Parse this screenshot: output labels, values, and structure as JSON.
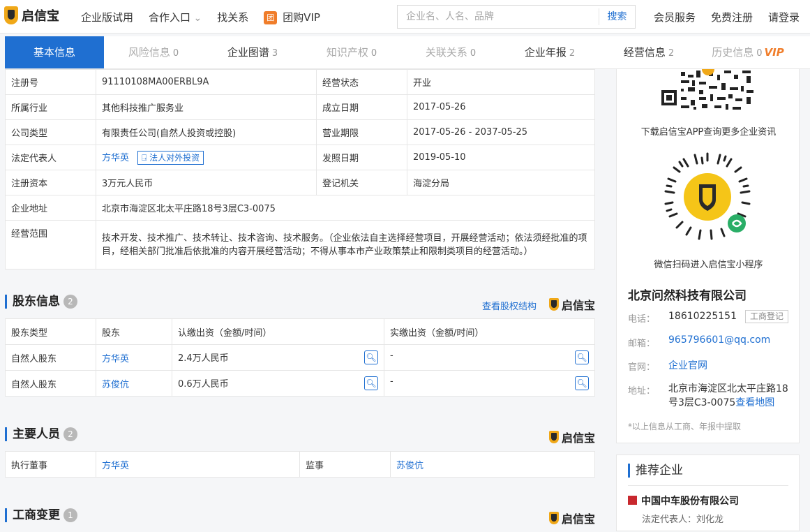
{
  "header": {
    "logo_text": "启信宝",
    "nav": [
      "企业版试用",
      "合作入口",
      "找关系",
      "团购VIP"
    ],
    "vip_icon_char": "团",
    "search_placeholder": "企业名、人名、品牌",
    "search_button": "搜索",
    "right_links": [
      "会员服务",
      "免费注册",
      "请登录"
    ]
  },
  "tabs": [
    {
      "label": "基本信息",
      "count": "",
      "state": "active"
    },
    {
      "label": "风险信息",
      "count": "0",
      "state": "disabled"
    },
    {
      "label": "企业图谱",
      "count": "3",
      "state": "normal"
    },
    {
      "label": "知识产权",
      "count": "0",
      "state": "disabled"
    },
    {
      "label": "关联关系",
      "count": "0",
      "state": "disabled"
    },
    {
      "label": "企业年报",
      "count": "2",
      "state": "normal"
    },
    {
      "label": "经营信息",
      "count": "2",
      "state": "normal"
    },
    {
      "label": "历史信息",
      "count": "0",
      "state": "disabled",
      "vip": "VIP"
    }
  ],
  "basic_info": {
    "reg_no_label": "注册号",
    "reg_no": "91110108MA00ERBL9A",
    "status_label": "经营状态",
    "status": "开业",
    "industry_label": "所属行业",
    "industry": "其他科技推广服务业",
    "founded_label": "成立日期",
    "founded": "2017-05-26",
    "type_label": "公司类型",
    "type": "有限责任公司(自然人投资或控股)",
    "term_label": "营业期限",
    "term": "2017-05-26 - 2037-05-25",
    "legal_label": "法定代表人",
    "legal": "方华英",
    "legal_btn": "法人对外投资",
    "issue_label": "发照日期",
    "issue": "2019-05-10",
    "capital_label": "注册资本",
    "capital": "3万元人民币",
    "authority_label": "登记机关",
    "authority": "海淀分局",
    "address_label": "企业地址",
    "address": "北京市海淀区北太平庄路18号3层C3-0075",
    "scope_label": "经营范围",
    "scope": "技术开发、技术推广、技术转让、技术咨询、技术服务。（企业依法自主选择经营项目，开展经营活动；依法须经批准的项目，经相关部门批准后依批准的内容开展经营活动；不得从事本市产业政策禁止和限制类项目的经营活动。）"
  },
  "shareholders": {
    "title": "股东信息",
    "count": "2",
    "link": "查看股权结构",
    "brand": "启信宝",
    "headers": [
      "股东类型",
      "股东",
      "认缴出资（金额/时间）",
      "实缴出资（金额/时间）"
    ],
    "rows": [
      {
        "type": "自然人股东",
        "name": "方华英",
        "subscribed": "2.4万人民币",
        "paid": "-"
      },
      {
        "type": "自然人股东",
        "name": "苏俊伉",
        "subscribed": "0.6万人民币",
        "paid": "-"
      }
    ]
  },
  "personnel": {
    "title": "主要人员",
    "count": "2",
    "brand": "启信宝",
    "role1": "执行董事",
    "name1": "方华英",
    "role2": "监事",
    "name2": "苏俊伉"
  },
  "changes": {
    "title": "工商变更",
    "count": "1",
    "brand": "启信宝"
  },
  "sidebar": {
    "app_caption": "下载启信宝APP查询更多企业资讯",
    "mini_caption": "微信扫码进入启信宝小程序",
    "company": "北京问然科技有限公司",
    "phone_label": "电话：",
    "phone": "18610225151",
    "phone_tag": "工商登记",
    "email_label": "邮箱：",
    "email": "965796601@qq.com",
    "site_label": "官网：",
    "site": "企业官网",
    "addr_label": "地址：",
    "addr1": "北京市海淀区北太平庄路18",
    "addr2": "号3层C3-0075",
    "map_link": "查看地图",
    "note": "*以上信息从工商、年报中提取"
  },
  "recommend": {
    "title": "推荐企业",
    "company": "中国中车股份有限公司",
    "rep": "法定代表人：刘化龙"
  },
  "colors": {
    "accent": "#1f6fd1",
    "brand_yellow": "#f0a818",
    "vip_orange": "#f07d2a"
  }
}
